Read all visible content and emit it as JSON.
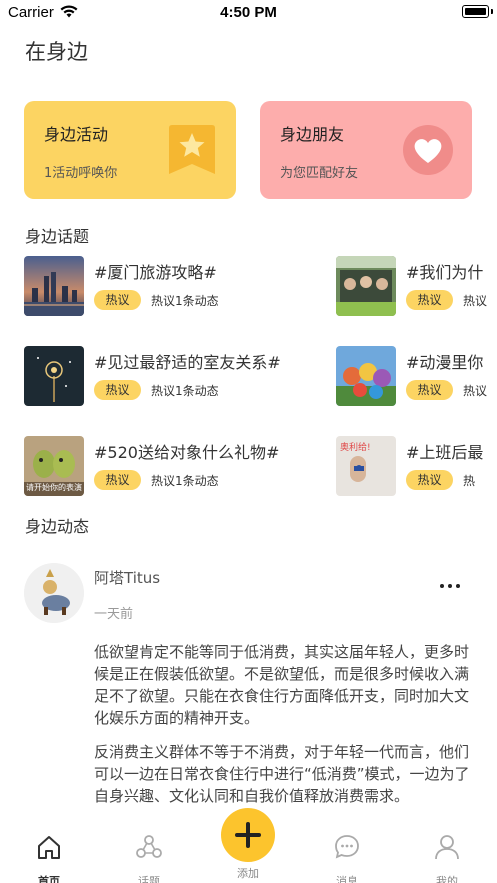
{
  "status_bar": {
    "carrier": "Carrier",
    "time": "4:50 PM"
  },
  "page_title": "在身边",
  "cards": {
    "activity": {
      "title": "身边活动",
      "subtitle": "1活动呼唤你",
      "icon": "star-bookmark-icon",
      "color": "#fcd462"
    },
    "friends": {
      "title": "身边朋友",
      "subtitle": "为您匹配好友",
      "icon": "heart-icon",
      "color": "#fdadac"
    }
  },
  "topics_section": {
    "title": "身边话题"
  },
  "topics": [
    {
      "title": "#厦门旅游攻略#",
      "badge": "热议",
      "count": "热议1条动态"
    },
    {
      "title": "#我们为什",
      "badge": "热议",
      "count": "热议"
    },
    {
      "title": "#见过最舒适的室友关系#",
      "badge": "热议",
      "count": "热议1条动态"
    },
    {
      "title": "#动漫里你",
      "badge": "热议",
      "count": "热议"
    },
    {
      "title": "#520送给对象什么礼物#",
      "badge": "热议",
      "count": "热议1条动态",
      "thumb_caption": "请开始你的表演"
    },
    {
      "title": "#上班后最",
      "badge": "热议",
      "count": "热",
      "thumb_caption": "奥利给!"
    }
  ],
  "feed_section": {
    "title": "身边动态"
  },
  "post": {
    "user": "阿塔Titus",
    "time": "一天前",
    "paragraph1": "低欲望肯定不能等同于低消费，其实这届年轻人，更多时候是正在假装低欲望。不是欲望低，而是很多时候收入满足不了欲望。只能在衣食住行方面降低开支，同时加大文化娱乐方面的精神开支。",
    "paragraph2": "反消费主义群体不等于不消费，对于年轻一代而言，他们可以一边在日常衣食住行中进行“低消费”模式，一边为了自身兴趣、文化认同和自我价值释放消费需求。"
  },
  "tabbar": {
    "home": "首页",
    "topics": "话题",
    "add": "添加",
    "messages": "消息",
    "mine": "我的"
  },
  "colors": {
    "accent": "#fcc42d",
    "card_yellow": "#fcd462",
    "card_pink": "#fdadac",
    "heart_circle": "#f08c8a"
  }
}
